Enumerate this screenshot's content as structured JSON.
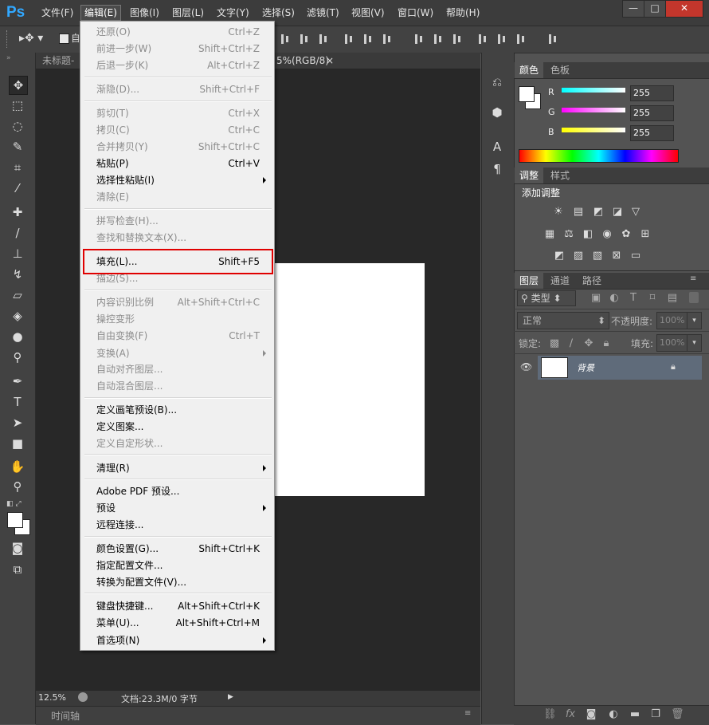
{
  "app": {
    "logo": "Ps"
  },
  "menubar": {
    "items": [
      "文件(F)",
      "编辑(E)",
      "图像(I)",
      "图层(L)",
      "文字(Y)",
      "选择(S)",
      "滤镜(T)",
      "视图(V)",
      "窗口(W)",
      "帮助(H)"
    ],
    "active_index": 1
  },
  "window_controls": {
    "minimize": "—",
    "maximize": "□",
    "close": "✕"
  },
  "document": {
    "tab_title": "未标题-",
    "tab_title_suffix": "5%(RGB/8)",
    "tab_close": "×"
  },
  "status": {
    "zoom": "12.5%",
    "doc_info": "文档:23.3M/0 字节"
  },
  "timeline": {
    "label": "时间轴"
  },
  "color_panel": {
    "tabs": [
      "颜色",
      "色板"
    ],
    "channels": [
      {
        "label": "R",
        "value": "255",
        "color": "#00ffff"
      },
      {
        "label": "G",
        "value": "255",
        "color": "#ff00ff"
      },
      {
        "label": "B",
        "value": "255",
        "color": "#ffff00"
      }
    ]
  },
  "adjustments_panel": {
    "tabs": [
      "调整",
      "样式"
    ],
    "title": "添加调整"
  },
  "layers_panel": {
    "tabs": [
      "图层",
      "通道",
      "路径"
    ],
    "filter_kind": "类型",
    "blend_mode": "正常",
    "opacity_label": "不透明度:",
    "opacity_value": "100%",
    "lock_label": "锁定:",
    "fill_label": "填充:",
    "fill_value": "100%",
    "layer_name": "背景"
  },
  "edit_menu": {
    "items": [
      {
        "label": "还原(O)",
        "shortcut": "Ctrl+Z",
        "disabled": true
      },
      {
        "label": "前进一步(W)",
        "shortcut": "Shift+Ctrl+Z",
        "disabled": true
      },
      {
        "label": "后退一步(K)",
        "shortcut": "Alt+Ctrl+Z",
        "disabled": true
      },
      {
        "label": "渐隐(D)...",
        "shortcut": "Shift+Ctrl+F",
        "disabled": true
      },
      {
        "label": "剪切(T)",
        "shortcut": "Ctrl+X",
        "disabled": true
      },
      {
        "label": "拷贝(C)",
        "shortcut": "Ctrl+C",
        "disabled": true
      },
      {
        "label": "合并拷贝(Y)",
        "shortcut": "Shift+Ctrl+C",
        "disabled": true
      },
      {
        "label": "粘贴(P)",
        "shortcut": "Ctrl+V",
        "disabled": false
      },
      {
        "label": "选择性粘贴(I)",
        "shortcut": "",
        "disabled": false,
        "submenu": true
      },
      {
        "label": "清除(E)",
        "shortcut": "",
        "disabled": true
      },
      {
        "label": "拼写检查(H)...",
        "shortcut": "",
        "disabled": true
      },
      {
        "label": "查找和替换文本(X)...",
        "shortcut": "",
        "disabled": true
      },
      {
        "label": "填充(L)...",
        "shortcut": "Shift+F5",
        "disabled": false,
        "highlighted": true
      },
      {
        "label": "描边(S)...",
        "shortcut": "",
        "disabled": true
      },
      {
        "label": "内容识别比例",
        "shortcut": "Alt+Shift+Ctrl+C",
        "disabled": true
      },
      {
        "label": "操控变形",
        "shortcut": "",
        "disabled": true
      },
      {
        "label": "自由变换(F)",
        "shortcut": "Ctrl+T",
        "disabled": true
      },
      {
        "label": "变换(A)",
        "shortcut": "",
        "disabled": true,
        "submenu": true
      },
      {
        "label": "自动对齐图层...",
        "shortcut": "",
        "disabled": true
      },
      {
        "label": "自动混合图层...",
        "shortcut": "",
        "disabled": true
      },
      {
        "label": "定义画笔预设(B)...",
        "shortcut": "",
        "disabled": false
      },
      {
        "label": "定义图案...",
        "shortcut": "",
        "disabled": false
      },
      {
        "label": "定义自定形状...",
        "shortcut": "",
        "disabled": true
      },
      {
        "label": "清理(R)",
        "shortcut": "",
        "disabled": false,
        "submenu": true
      },
      {
        "label": "Adobe PDF 预设...",
        "shortcut": "",
        "disabled": false
      },
      {
        "label": "预设",
        "shortcut": "",
        "disabled": false,
        "submenu": true
      },
      {
        "label": "远程连接...",
        "shortcut": "",
        "disabled": false
      },
      {
        "label": "颜色设置(G)...",
        "shortcut": "Shift+Ctrl+K",
        "disabled": false
      },
      {
        "label": "指定配置文件...",
        "shortcut": "",
        "disabled": false
      },
      {
        "label": "转换为配置文件(V)...",
        "shortcut": "",
        "disabled": false
      },
      {
        "label": "键盘快捷键...",
        "shortcut": "Alt+Shift+Ctrl+K",
        "disabled": false
      },
      {
        "label": "菜单(U)...",
        "shortcut": "Alt+Shift+Ctrl+M",
        "disabled": false
      },
      {
        "label": "首选项(N)",
        "shortcut": "",
        "disabled": false,
        "submenu": true
      }
    ]
  }
}
